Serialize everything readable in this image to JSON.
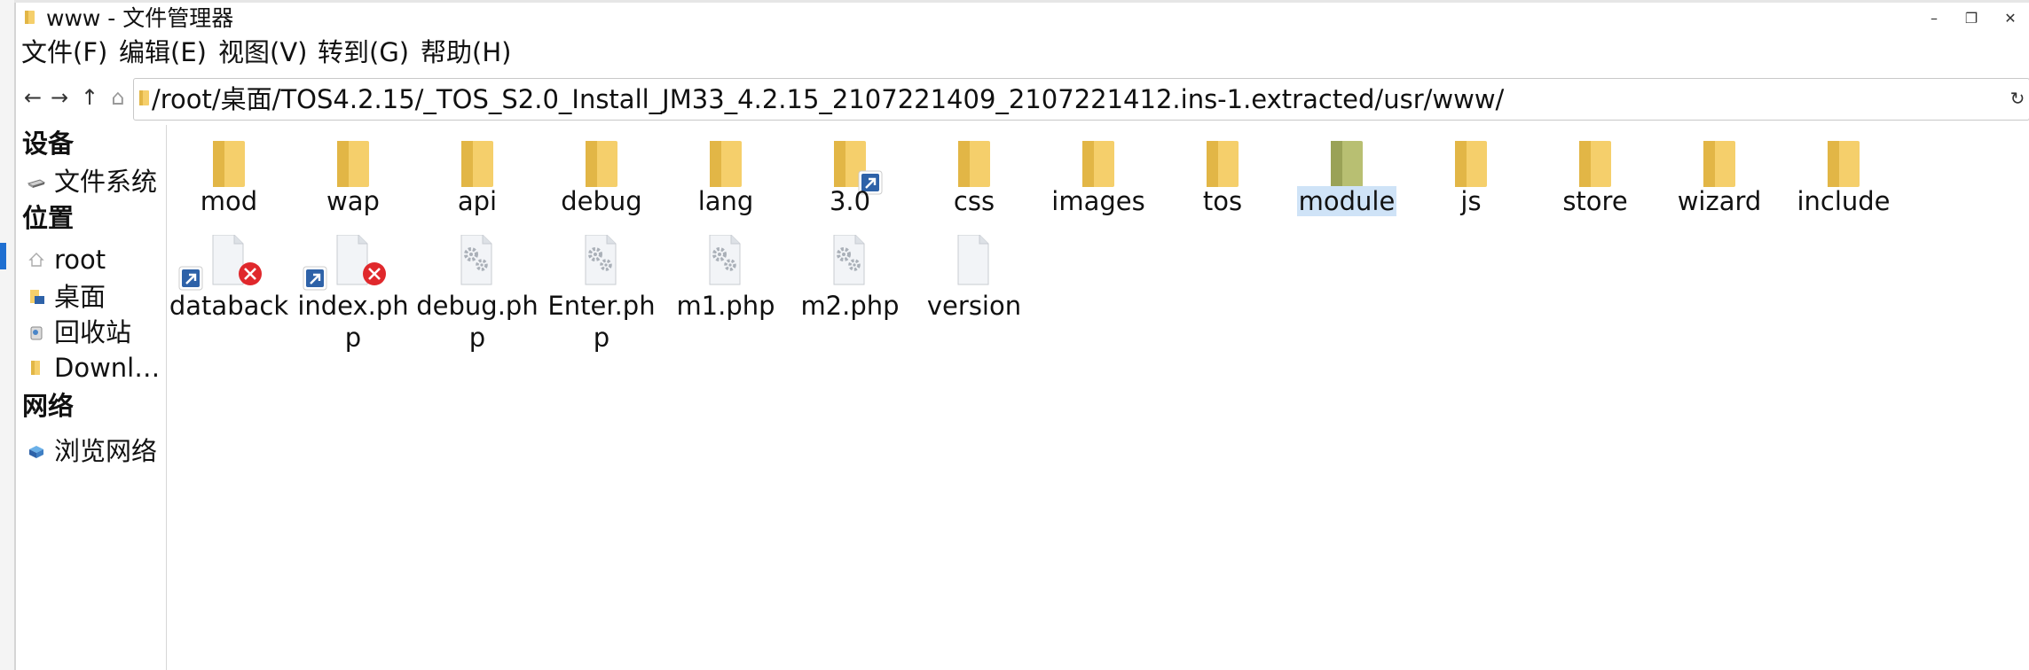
{
  "window": {
    "title": "www - 文件管理器",
    "controls": {
      "minimize": "–",
      "maximize": "❐",
      "close": "✕"
    }
  },
  "menubar": {
    "items": [
      "文件(F)",
      "编辑(E)",
      "视图(V)",
      "转到(G)",
      "帮助(H)"
    ]
  },
  "toolbar": {
    "back_icon": "←",
    "forward_icon": "→",
    "up_icon": "↑",
    "home_icon": "⌂",
    "path": "/root/桌面/TOS4.2.15/_TOS_S2.0_Install_JM33_4.2.15_2107221409_2107221412.ins-1.extracted/usr/www/",
    "reload_icon": "↻"
  },
  "sidebar": {
    "devices_heading": "设备",
    "devices": [
      {
        "label": "文件系统",
        "icon": "drive-icon"
      }
    ],
    "places_heading": "位置",
    "places": [
      {
        "label": "root",
        "icon": "home-icon"
      },
      {
        "label": "桌面",
        "icon": "desktop-folder-icon"
      },
      {
        "label": "回收站",
        "icon": "trash-icon"
      },
      {
        "label": "Downl…",
        "icon": "folder-icon"
      }
    ],
    "network_heading": "网络",
    "network": [
      {
        "label": "浏览网络",
        "icon": "network-icon"
      }
    ]
  },
  "files": {
    "row1": [
      {
        "name": "mod",
        "type": "folder"
      },
      {
        "name": "wap",
        "type": "folder"
      },
      {
        "name": "api",
        "type": "folder"
      },
      {
        "name": "debug",
        "type": "folder"
      },
      {
        "name": "lang",
        "type": "folder"
      },
      {
        "name": "3.0",
        "type": "folder-symlink"
      },
      {
        "name": "css",
        "type": "folder"
      },
      {
        "name": "images",
        "type": "folder"
      },
      {
        "name": "tos",
        "type": "folder"
      },
      {
        "name": "module",
        "type": "folder-selected"
      },
      {
        "name": "js",
        "type": "folder"
      },
      {
        "name": "store",
        "type": "folder"
      },
      {
        "name": "wizard",
        "type": "folder"
      },
      {
        "name": "include",
        "type": "folder"
      }
    ],
    "row2": [
      {
        "name_line1": "databack",
        "name_line2": "",
        "type": "broken-symlink"
      },
      {
        "name_line1": "index.ph",
        "name_line2": "p",
        "type": "broken-symlink"
      },
      {
        "name_line1": "debug.ph",
        "name_line2": "p",
        "type": "script"
      },
      {
        "name_line1": "Enter.ph",
        "name_line2": "p",
        "type": "script"
      },
      {
        "name_line1": "m1.php",
        "name_line2": "",
        "type": "script"
      },
      {
        "name_line1": "m2.php",
        "name_line2": "",
        "type": "script"
      },
      {
        "name_line1": "version",
        "name_line2": "",
        "type": "text-file"
      }
    ]
  },
  "colors": {
    "folder": "#f5cf6b",
    "folder_dark": "#e2b646",
    "folder_selected": "#b8bf72",
    "selection": "#cfe3f7",
    "link_badge": "#2e62a8",
    "error_badge": "#e0282c"
  }
}
